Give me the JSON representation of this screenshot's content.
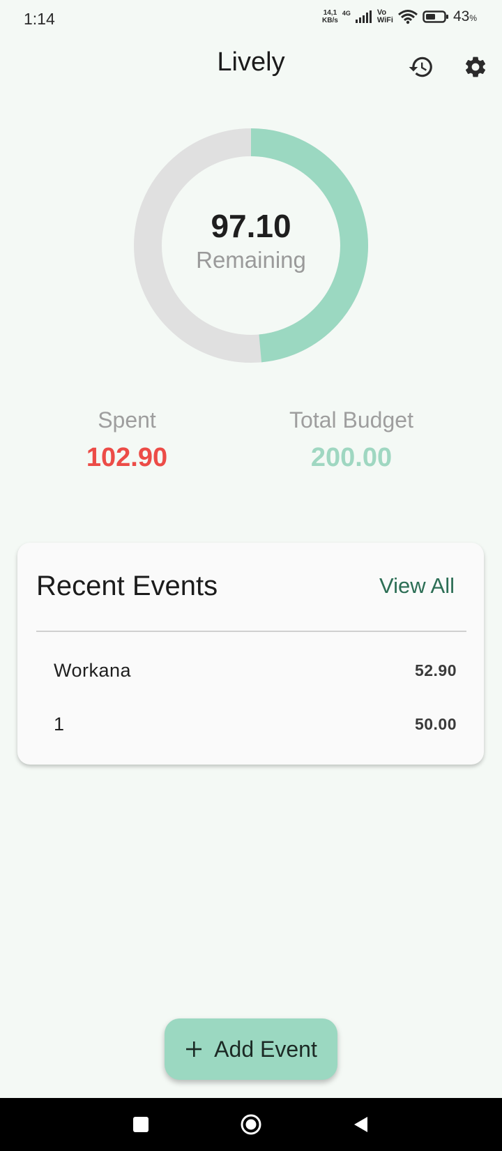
{
  "status_bar": {
    "time": "1:14",
    "net_speed_value": "14,1",
    "net_speed_unit": "KB/s",
    "network_type": "4G",
    "vowifi_top": "Vo",
    "vowifi_bottom": "WiFi",
    "battery_percent": "43",
    "battery_percent_sign": "%",
    "icons": [
      "signal-bars-icon",
      "wifi-icon",
      "battery-icon"
    ]
  },
  "app_bar": {
    "title": "Lively",
    "actions": [
      {
        "name": "history-button",
        "icon": "history-icon"
      },
      {
        "name": "settings-button",
        "icon": "gear-icon"
      }
    ]
  },
  "summary": {
    "remaining_value": "97.10",
    "remaining_label": "Remaining",
    "spent_label": "Spent",
    "spent_value": "102.90",
    "budget_label": "Total Budget",
    "budget_value": "200.00",
    "remaining_fraction": 0.4855,
    "colors": {
      "remaining_ring": "#9bd8c1",
      "track_ring": "#e0e0e0",
      "spent_text": "#ec4c47",
      "budget_text": "#9fd7c1"
    }
  },
  "recent_events": {
    "title": "Recent Events",
    "view_all_label": "View All",
    "items": [
      {
        "name": "Workana",
        "amount": "52.90"
      },
      {
        "name": "1",
        "amount": "50.00"
      }
    ]
  },
  "fab": {
    "label": "Add Event",
    "icon": "plus-icon",
    "color": "#9bd8c1"
  },
  "nav_bar": {
    "buttons": [
      "recents-icon",
      "home-icon",
      "back-icon"
    ]
  }
}
